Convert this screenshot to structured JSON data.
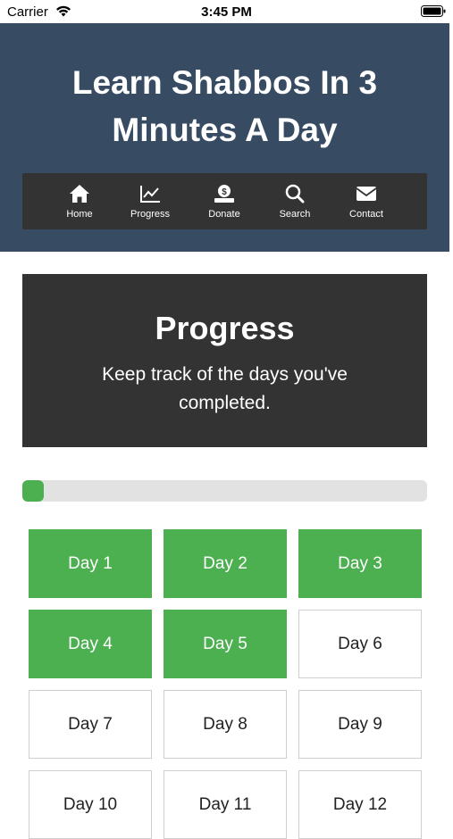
{
  "status_bar": {
    "carrier": "Carrier",
    "time": "3:45 PM"
  },
  "header": {
    "title": "Learn Shabbos In 3 Minutes A Day"
  },
  "nav": {
    "items": [
      {
        "label": "Home",
        "icon": "home-icon"
      },
      {
        "label": "Progress",
        "icon": "chart-icon"
      },
      {
        "label": "Donate",
        "icon": "donate-icon"
      },
      {
        "label": "Search",
        "icon": "search-icon"
      },
      {
        "label": "Contact",
        "icon": "envelope-icon"
      }
    ]
  },
  "progress": {
    "title": "Progress",
    "subtitle": "Keep track of the days you've completed.",
    "fraction": 0.05
  },
  "colors": {
    "header": "#374b63",
    "panel": "#333333",
    "accent": "#4caf50"
  },
  "days": [
    {
      "label": "Day 1",
      "completed": true
    },
    {
      "label": "Day 2",
      "completed": true
    },
    {
      "label": "Day 3",
      "completed": true
    },
    {
      "label": "Day 4",
      "completed": true
    },
    {
      "label": "Day 5",
      "completed": true
    },
    {
      "label": "Day 6",
      "completed": false
    },
    {
      "label": "Day 7",
      "completed": false
    },
    {
      "label": "Day 8",
      "completed": false
    },
    {
      "label": "Day 9",
      "completed": false
    },
    {
      "label": "Day 10",
      "completed": false
    },
    {
      "label": "Day 11",
      "completed": false
    },
    {
      "label": "Day 12",
      "completed": false
    }
  ]
}
